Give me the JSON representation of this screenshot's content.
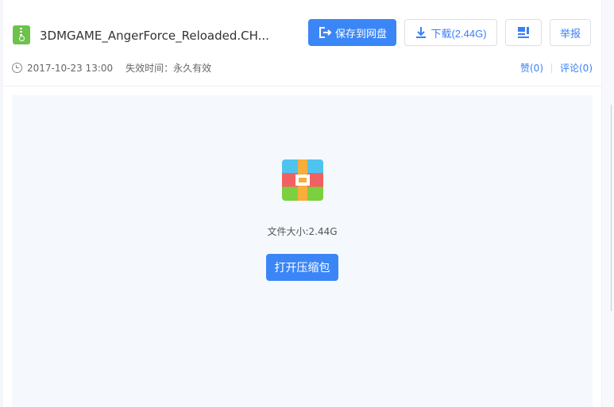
{
  "file": {
    "name": "3DMGAME_AngerForce_Reloaded.CH...",
    "date": "2017-10-23 13:00",
    "expiry": "失效时间：永久有效",
    "size_label": "文件大小:2.44G"
  },
  "toolbar": {
    "save": "保存到网盘",
    "download": "下载(2.44G)",
    "report": "举报"
  },
  "social": {
    "like": "赞(0)",
    "comment": "评论(0)"
  },
  "preview": {
    "open_button": "打开压缩包"
  },
  "colors": {
    "accent": "#3b86f7",
    "preview_bg": "#f5f8fd"
  }
}
